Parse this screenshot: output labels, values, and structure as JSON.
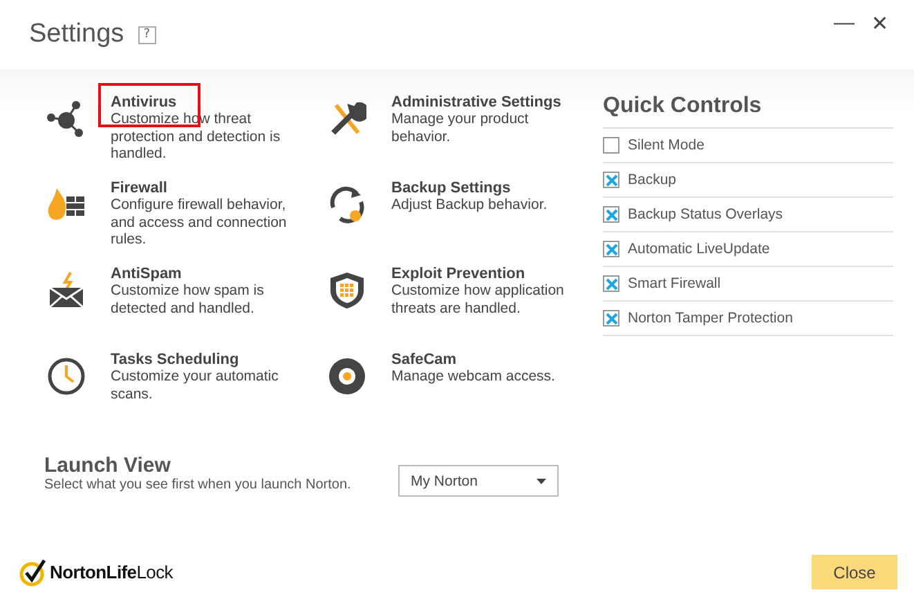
{
  "window": {
    "title": "Settings",
    "help": "?",
    "minimize": "—",
    "close": "✕"
  },
  "categories": [
    {
      "title": "Antivirus",
      "description": "Customize how threat protection and detection is handled.",
      "highlighted": true
    },
    {
      "title": "Administrative Settings",
      "description": "Manage your product behavior.",
      "highlighted": false
    },
    {
      "title": "Firewall",
      "description": "Configure firewall behavior, and access and connection rules.",
      "highlighted": false
    },
    {
      "title": "Backup Settings",
      "description": "Adjust Backup behavior.",
      "highlighted": false
    },
    {
      "title": "AntiSpam",
      "description": "Customize how spam is detected and handled.",
      "highlighted": false
    },
    {
      "title": "Exploit Prevention",
      "description": "Customize how application threats are handled.",
      "highlighted": false
    },
    {
      "title": "Tasks Scheduling",
      "description": "Customize your automatic scans.",
      "highlighted": false
    },
    {
      "title": "SafeCam",
      "description": "Manage webcam access.",
      "highlighted": false
    }
  ],
  "quick_controls": {
    "title": "Quick Controls",
    "items": [
      {
        "label": "Silent Mode",
        "checked": false
      },
      {
        "label": "Backup",
        "checked": true
      },
      {
        "label": "Backup Status Overlays",
        "checked": true
      },
      {
        "label": "Automatic LiveUpdate",
        "checked": true
      },
      {
        "label": "Smart Firewall",
        "checked": true
      },
      {
        "label": "Norton Tamper Protection",
        "checked": true
      }
    ]
  },
  "launch_view": {
    "title": "Launch View",
    "description": "Select what you see first when you launch Norton.",
    "value": "My Norton"
  },
  "logo": "**NortonLife**Lock",
  "close_button": "Close"
}
